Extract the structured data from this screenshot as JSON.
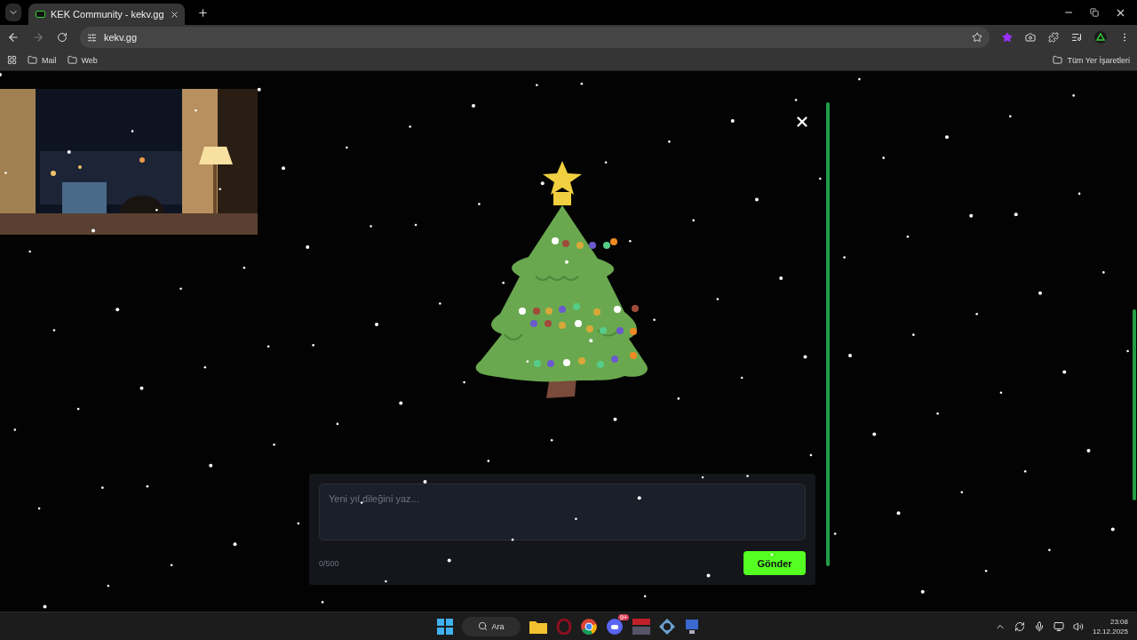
{
  "browser": {
    "tabs": [
      {
        "title": "KEK Community - kekv.gg",
        "selected": true
      }
    ],
    "address": "kekv.gg",
    "bookmarks": [
      {
        "label": "Mail"
      },
      {
        "label": "Web"
      }
    ],
    "all_bookmarks": "Tüm Yer İşaretleri"
  },
  "modal": {
    "wish_field": {
      "placeholder": "Yeni yıl dileğini yaz..."
    },
    "counter": "0/500",
    "submit": "Gönder"
  },
  "taskbar": {
    "search": "Ara",
    "discord_badge": "9+",
    "time": "23:08",
    "date": "12.12.2025"
  }
}
